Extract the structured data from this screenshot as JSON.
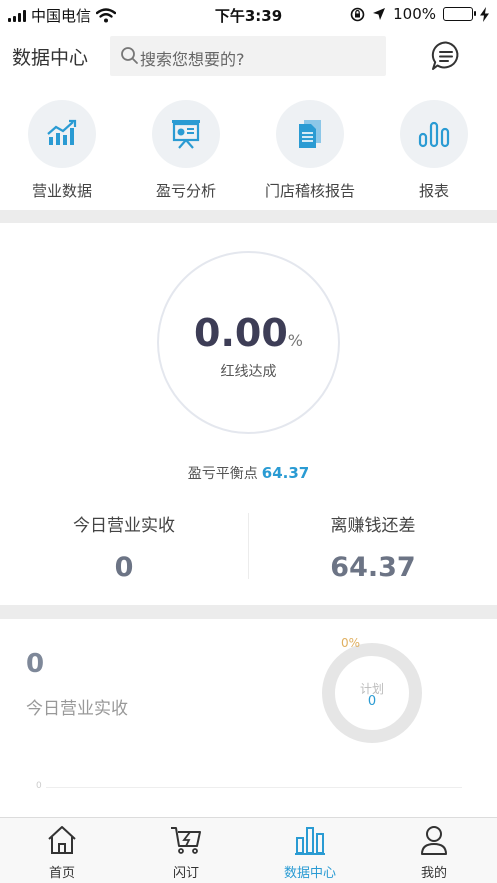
{
  "status_bar": {
    "carrier": "中国电信",
    "time": "下午3:39",
    "battery": "100%"
  },
  "header": {
    "title": "数据中心",
    "search_placeholder": "搜索您想要的?"
  },
  "quick_actions": [
    {
      "label": "营业数据",
      "icon": "trend-chart-icon"
    },
    {
      "label": "盈亏分析",
      "icon": "presentation-board-icon"
    },
    {
      "label": "门店稽核报告",
      "icon": "document-icon"
    },
    {
      "label": "报表",
      "icon": "bar-report-icon"
    }
  ],
  "kpi": {
    "percent_value": "0.00",
    "percent_unit": "%",
    "percent_label": "红线达成",
    "breakeven_label": "盈亏平衡点",
    "breakeven_value": "64.37",
    "left_label": "今日营业实收",
    "left_value": "0",
    "right_label": "离赚钱还差",
    "right_value": "64.37"
  },
  "revenue_panel": {
    "value": "0",
    "label": "今日营业实收",
    "ring_percent": "0%",
    "ring_label": "计划",
    "ring_value": "0",
    "axis_mark": "0"
  },
  "tabs": [
    {
      "label": "首页",
      "icon": "home-icon"
    },
    {
      "label": "闪订",
      "icon": "flash-cart-icon"
    },
    {
      "label": "数据中心",
      "icon": "bar-chart-icon"
    },
    {
      "label": "我的",
      "icon": "user-icon"
    }
  ],
  "colors": {
    "accent": "#2a9bd3",
    "separator": "#ececec",
    "ring_percent": "#e0b060"
  }
}
